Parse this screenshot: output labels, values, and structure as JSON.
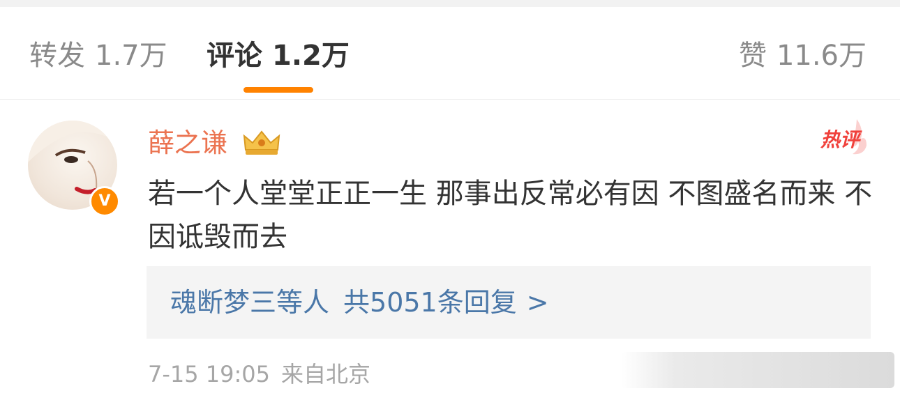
{
  "tabs": {
    "repost_label": "转发",
    "repost_count": "1.7万",
    "comments_label": "评论",
    "comments_count": "1.2万",
    "likes_label": "赞",
    "likes_count": "11.6万",
    "active_tab": "comments",
    "accent_color": "#ff8200"
  },
  "comment": {
    "username": "薛之谦",
    "username_color": "#eb7350",
    "verified_icon": "verified-v-icon",
    "vip_icon": "crown-icon",
    "hot_label": "热评",
    "text": "若一个人堂堂正正一生 那事出反常必有因 不图盛名而来 不因诋毁而去",
    "replies": {
      "names": "魂断梦三等人",
      "count_text": "共5051条回复",
      "arrow": ">"
    },
    "meta": {
      "time": "7-15 19:05",
      "location": "来自北京"
    }
  }
}
